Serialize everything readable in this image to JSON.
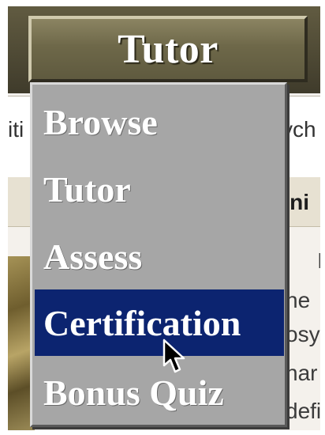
{
  "header": {
    "button_label": "Tutor"
  },
  "strip": {
    "left_fragment": "iti",
    "right_fragment": "ych"
  },
  "content": {
    "header_fragment": "fini",
    "lines": [
      "I",
      "he",
      "osy",
      "nar",
      "defi"
    ]
  },
  "menu": {
    "items": [
      {
        "label": "Browse"
      },
      {
        "label": "Tutor"
      },
      {
        "label": "Assess"
      },
      {
        "label": "Certification"
      },
      {
        "label": "Bonus Quiz"
      }
    ],
    "selected_index": 3
  },
  "colors": {
    "band": "#4f4a35",
    "menu_bg": "#a6a6a6",
    "selected_bg": "#0c2470"
  },
  "icons": [
    "mouse-pointer-icon"
  ]
}
